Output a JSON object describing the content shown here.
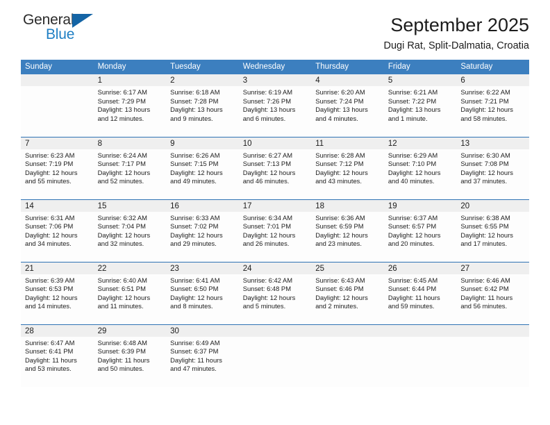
{
  "logo": {
    "word_one": "General",
    "word_two": "Blue",
    "triangle_color": "#1464a5",
    "blue_color": "#1f7fc4"
  },
  "header": {
    "title": "September 2025",
    "subtitle": "Dugi Rat, Split-Dalmatia, Croatia"
  },
  "theme": {
    "header_row_bg": "#3c7fbf",
    "week_divider": "#2d72b4",
    "daynum_band_bg": "#efefef",
    "cell_bg": "#fdfdfd",
    "text": "#1c1c1c"
  },
  "weekdays": [
    "Sunday",
    "Monday",
    "Tuesday",
    "Wednesday",
    "Thursday",
    "Friday",
    "Saturday"
  ],
  "weeks": [
    [
      {
        "day": "",
        "sunrise": "",
        "sunset": "",
        "daylight_line1": "",
        "daylight_line2": ""
      },
      {
        "day": "1",
        "sunrise": "Sunrise: 6:17 AM",
        "sunset": "Sunset: 7:29 PM",
        "daylight_line1": "Daylight: 13 hours",
        "daylight_line2": "and 12 minutes."
      },
      {
        "day": "2",
        "sunrise": "Sunrise: 6:18 AM",
        "sunset": "Sunset: 7:28 PM",
        "daylight_line1": "Daylight: 13 hours",
        "daylight_line2": "and 9 minutes."
      },
      {
        "day": "3",
        "sunrise": "Sunrise: 6:19 AM",
        "sunset": "Sunset: 7:26 PM",
        "daylight_line1": "Daylight: 13 hours",
        "daylight_line2": "and 6 minutes."
      },
      {
        "day": "4",
        "sunrise": "Sunrise: 6:20 AM",
        "sunset": "Sunset: 7:24 PM",
        "daylight_line1": "Daylight: 13 hours",
        "daylight_line2": "and 4 minutes."
      },
      {
        "day": "5",
        "sunrise": "Sunrise: 6:21 AM",
        "sunset": "Sunset: 7:22 PM",
        "daylight_line1": "Daylight: 13 hours",
        "daylight_line2": "and 1 minute."
      },
      {
        "day": "6",
        "sunrise": "Sunrise: 6:22 AM",
        "sunset": "Sunset: 7:21 PM",
        "daylight_line1": "Daylight: 12 hours",
        "daylight_line2": "and 58 minutes."
      }
    ],
    [
      {
        "day": "7",
        "sunrise": "Sunrise: 6:23 AM",
        "sunset": "Sunset: 7:19 PM",
        "daylight_line1": "Daylight: 12 hours",
        "daylight_line2": "and 55 minutes."
      },
      {
        "day": "8",
        "sunrise": "Sunrise: 6:24 AM",
        "sunset": "Sunset: 7:17 PM",
        "daylight_line1": "Daylight: 12 hours",
        "daylight_line2": "and 52 minutes."
      },
      {
        "day": "9",
        "sunrise": "Sunrise: 6:26 AM",
        "sunset": "Sunset: 7:15 PM",
        "daylight_line1": "Daylight: 12 hours",
        "daylight_line2": "and 49 minutes."
      },
      {
        "day": "10",
        "sunrise": "Sunrise: 6:27 AM",
        "sunset": "Sunset: 7:13 PM",
        "daylight_line1": "Daylight: 12 hours",
        "daylight_line2": "and 46 minutes."
      },
      {
        "day": "11",
        "sunrise": "Sunrise: 6:28 AM",
        "sunset": "Sunset: 7:12 PM",
        "daylight_line1": "Daylight: 12 hours",
        "daylight_line2": "and 43 minutes."
      },
      {
        "day": "12",
        "sunrise": "Sunrise: 6:29 AM",
        "sunset": "Sunset: 7:10 PM",
        "daylight_line1": "Daylight: 12 hours",
        "daylight_line2": "and 40 minutes."
      },
      {
        "day": "13",
        "sunrise": "Sunrise: 6:30 AM",
        "sunset": "Sunset: 7:08 PM",
        "daylight_line1": "Daylight: 12 hours",
        "daylight_line2": "and 37 minutes."
      }
    ],
    [
      {
        "day": "14",
        "sunrise": "Sunrise: 6:31 AM",
        "sunset": "Sunset: 7:06 PM",
        "daylight_line1": "Daylight: 12 hours",
        "daylight_line2": "and 34 minutes."
      },
      {
        "day": "15",
        "sunrise": "Sunrise: 6:32 AM",
        "sunset": "Sunset: 7:04 PM",
        "daylight_line1": "Daylight: 12 hours",
        "daylight_line2": "and 32 minutes."
      },
      {
        "day": "16",
        "sunrise": "Sunrise: 6:33 AM",
        "sunset": "Sunset: 7:02 PM",
        "daylight_line1": "Daylight: 12 hours",
        "daylight_line2": "and 29 minutes."
      },
      {
        "day": "17",
        "sunrise": "Sunrise: 6:34 AM",
        "sunset": "Sunset: 7:01 PM",
        "daylight_line1": "Daylight: 12 hours",
        "daylight_line2": "and 26 minutes."
      },
      {
        "day": "18",
        "sunrise": "Sunrise: 6:36 AM",
        "sunset": "Sunset: 6:59 PM",
        "daylight_line1": "Daylight: 12 hours",
        "daylight_line2": "and 23 minutes."
      },
      {
        "day": "19",
        "sunrise": "Sunrise: 6:37 AM",
        "sunset": "Sunset: 6:57 PM",
        "daylight_line1": "Daylight: 12 hours",
        "daylight_line2": "and 20 minutes."
      },
      {
        "day": "20",
        "sunrise": "Sunrise: 6:38 AM",
        "sunset": "Sunset: 6:55 PM",
        "daylight_line1": "Daylight: 12 hours",
        "daylight_line2": "and 17 minutes."
      }
    ],
    [
      {
        "day": "21",
        "sunrise": "Sunrise: 6:39 AM",
        "sunset": "Sunset: 6:53 PM",
        "daylight_line1": "Daylight: 12 hours",
        "daylight_line2": "and 14 minutes."
      },
      {
        "day": "22",
        "sunrise": "Sunrise: 6:40 AM",
        "sunset": "Sunset: 6:51 PM",
        "daylight_line1": "Daylight: 12 hours",
        "daylight_line2": "and 11 minutes."
      },
      {
        "day": "23",
        "sunrise": "Sunrise: 6:41 AM",
        "sunset": "Sunset: 6:50 PM",
        "daylight_line1": "Daylight: 12 hours",
        "daylight_line2": "and 8 minutes."
      },
      {
        "day": "24",
        "sunrise": "Sunrise: 6:42 AM",
        "sunset": "Sunset: 6:48 PM",
        "daylight_line1": "Daylight: 12 hours",
        "daylight_line2": "and 5 minutes."
      },
      {
        "day": "25",
        "sunrise": "Sunrise: 6:43 AM",
        "sunset": "Sunset: 6:46 PM",
        "daylight_line1": "Daylight: 12 hours",
        "daylight_line2": "and 2 minutes."
      },
      {
        "day": "26",
        "sunrise": "Sunrise: 6:45 AM",
        "sunset": "Sunset: 6:44 PM",
        "daylight_line1": "Daylight: 11 hours",
        "daylight_line2": "and 59 minutes."
      },
      {
        "day": "27",
        "sunrise": "Sunrise: 6:46 AM",
        "sunset": "Sunset: 6:42 PM",
        "daylight_line1": "Daylight: 11 hours",
        "daylight_line2": "and 56 minutes."
      }
    ],
    [
      {
        "day": "28",
        "sunrise": "Sunrise: 6:47 AM",
        "sunset": "Sunset: 6:41 PM",
        "daylight_line1": "Daylight: 11 hours",
        "daylight_line2": "and 53 minutes."
      },
      {
        "day": "29",
        "sunrise": "Sunrise: 6:48 AM",
        "sunset": "Sunset: 6:39 PM",
        "daylight_line1": "Daylight: 11 hours",
        "daylight_line2": "and 50 minutes."
      },
      {
        "day": "30",
        "sunrise": "Sunrise: 6:49 AM",
        "sunset": "Sunset: 6:37 PM",
        "daylight_line1": "Daylight: 11 hours",
        "daylight_line2": "and 47 minutes."
      },
      {
        "day": "",
        "sunrise": "",
        "sunset": "",
        "daylight_line1": "",
        "daylight_line2": ""
      },
      {
        "day": "",
        "sunrise": "",
        "sunset": "",
        "daylight_line1": "",
        "daylight_line2": ""
      },
      {
        "day": "",
        "sunrise": "",
        "sunset": "",
        "daylight_line1": "",
        "daylight_line2": ""
      },
      {
        "day": "",
        "sunrise": "",
        "sunset": "",
        "daylight_line1": "",
        "daylight_line2": ""
      }
    ]
  ]
}
